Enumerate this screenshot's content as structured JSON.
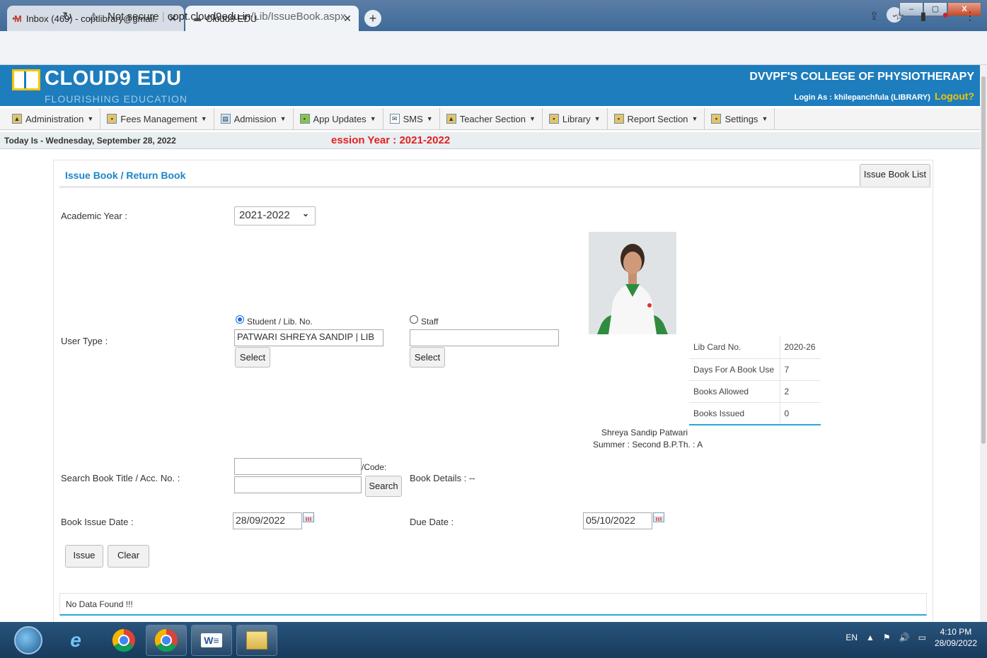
{
  "browser": {
    "tabs": [
      {
        "title": "Inbox (469) - coptlibrary@gmail.",
        "icon": "gmail-icon"
      },
      {
        "title": "Cloud9 EDU",
        "icon": "cloud-icon"
      }
    ],
    "url_security": "Not secure",
    "url_host": "copt.cloud9edu.in",
    "url_path": "/Lib/IssueBook.aspx"
  },
  "header": {
    "logo_title": "CLOUD9 EDU",
    "logo_subtitle": "FLOURISHING EDUCATION",
    "college": "DVVPF'S COLLEGE OF PHYSIOTHERAPY",
    "login_as": "Login As : khilepanchfula (LIBRARY)",
    "logout": "Logout?"
  },
  "menu": [
    {
      "label": "Administration",
      "icon": "user-icon"
    },
    {
      "label": "Fees Management",
      "icon": "module-icon"
    },
    {
      "label": "Admission",
      "icon": "form-icon"
    },
    {
      "label": "App Updates",
      "icon": "android-icon"
    },
    {
      "label": "SMS",
      "icon": "mail-icon"
    },
    {
      "label": "Teacher Section",
      "icon": "user-icon"
    },
    {
      "label": "Library",
      "icon": "module-icon"
    },
    {
      "label": "Report Section",
      "icon": "module-icon"
    },
    {
      "label": "Settings",
      "icon": "module-icon"
    }
  ],
  "infobar": {
    "today": "Today Is - Wednesday, September 28, 2022",
    "session": "ession Year : 2021-2022"
  },
  "page": {
    "title": "Issue Book  / Return Book",
    "issue_list_button": "Issue Book List",
    "academic_year_label": "Academic Year :",
    "academic_year_value": "2021-2022",
    "user_type_label": "User Type :",
    "student_radio_label": "Student / Lib. No.",
    "student_value": "PATWARI SHREYA SANDIP | LIB",
    "staff_radio_label": "Staff",
    "staff_value": "",
    "select_label": "Select",
    "lib_card": [
      {
        "key": "Lib Card No.",
        "value": "2020-26"
      },
      {
        "key": "Days For A Book Use",
        "value": "7"
      },
      {
        "key": "Books Allowed",
        "value": "2"
      },
      {
        "key": "Books Issued",
        "value": "0"
      }
    ],
    "student_name": "Shreya Sandip Patwari",
    "student_class": "Summer : Second B.P.Th. : A",
    "search_label": "Search Book Title / Acc. No. :",
    "code_label": "/Code:",
    "search_button": "Search",
    "book_details": "Book Details : --",
    "issue_date_label": "Book Issue Date :",
    "issue_date_value": "28/09/2022",
    "due_date_label": "Due Date :",
    "due_date_value": "05/10/2022",
    "issue_button": "Issue",
    "clear_button": "Clear",
    "no_data": "No Data Found !!!"
  },
  "taskbar": {
    "lang": "EN",
    "time": "4:10 PM",
    "date": "28/09/2022"
  }
}
